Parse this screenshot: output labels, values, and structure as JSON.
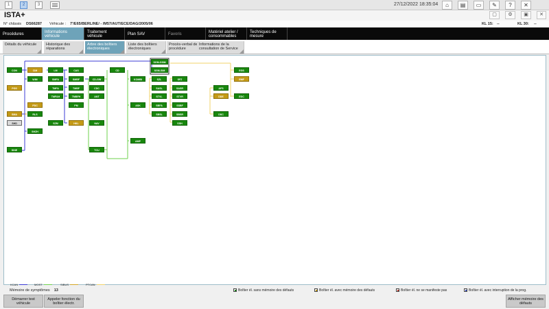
{
  "topbar": {
    "nav_buttons": [
      "1",
      "2",
      "3"
    ],
    "datetime": "27/12/2022 18:35:04",
    "icons": [
      "home-icon",
      "print-icon",
      "car-icon",
      "wrench-icon",
      "help-icon",
      "close-icon"
    ]
  },
  "app": {
    "title": "ISTA+"
  },
  "infobar": {
    "chassis_label": "N° châssis",
    "chassis_value": "DS66287",
    "vehicle_label": "Véhicule :",
    "vehicle_value": "7'/E65/BERLINE/ - /M57/AUT/ECE/DAG/2005/06",
    "kl15_label": "KL 15:",
    "kl15_value": "--",
    "kl30_label": "KL 30:",
    "kl30_value": "--"
  },
  "main_tabs": [
    {
      "label": "Procédures"
    },
    {
      "label": "Informations véhicule"
    },
    {
      "label": "Traitement véhicule"
    },
    {
      "label": "Plan SAV"
    },
    {
      "label": "Favoris"
    },
    {
      "label": "Matériel atelier / consommables"
    },
    {
      "label": "Techniques de mesure"
    }
  ],
  "sub_tabs": [
    {
      "label": "Détails du véhicule"
    },
    {
      "label": "Historique des réparations"
    },
    {
      "label": "Arbre des boîtiers électroniques"
    },
    {
      "label": "Liste des boîtiers électroniques"
    },
    {
      "label": "Procès-verbal de procédure"
    },
    {
      "label": "Informations de la consultation de Service"
    }
  ],
  "ecus": [
    {
      "label": "CON",
      "color": "green"
    },
    {
      "label": "CIM",
      "color": "yellow"
    },
    {
      "label": "WIM",
      "color": "green"
    },
    {
      "label": "PGS",
      "color": "yellow"
    },
    {
      "label": "PDC",
      "color": "yellow"
    },
    {
      "label": "SMA",
      "color": "yellow"
    },
    {
      "label": "RLS",
      "color": "green"
    },
    {
      "label": "SHD",
      "color": "grey"
    },
    {
      "label": "SHZH",
      "color": "green"
    },
    {
      "label": "SINE",
      "color": "green"
    },
    {
      "label": "LM",
      "color": "green"
    },
    {
      "label": "SMFA",
      "color": "green"
    },
    {
      "label": "TMFA",
      "color": "green"
    },
    {
      "label": "TMFAH",
      "color": "green"
    },
    {
      "label": "SZM",
      "color": "green"
    },
    {
      "label": "CAS",
      "color": "green"
    },
    {
      "label": "SMBF",
      "color": "green"
    },
    {
      "label": "TMBF",
      "color": "green"
    },
    {
      "label": "TMBFH",
      "color": "green"
    },
    {
      "label": "PM",
      "color": "green"
    },
    {
      "label": "HKL",
      "color": "yellow"
    },
    {
      "label": "CD-GW",
      "color": "green"
    },
    {
      "label": "CDC",
      "color": "green"
    },
    {
      "label": "ANT",
      "color": "green"
    },
    {
      "label": "NAV",
      "color": "green"
    },
    {
      "label": "TCU",
      "color": "green"
    },
    {
      "label": "CD",
      "color": "green"
    },
    {
      "label": "KOMBI",
      "color": "green"
    },
    {
      "label": "ASK",
      "color": "green"
    },
    {
      "label": "AMP",
      "color": "green"
    },
    {
      "label": "SGM-GGM",
      "color": "green"
    },
    {
      "label": "SGM-SIM",
      "color": "green"
    },
    {
      "label": "SZL",
      "color": "green"
    },
    {
      "label": "SASL",
      "color": "green"
    },
    {
      "label": "STVL",
      "color": "green"
    },
    {
      "label": "SBFA",
      "color": "green"
    },
    {
      "label": "SBSL",
      "color": "green"
    },
    {
      "label": "SFZ",
      "color": "green"
    },
    {
      "label": "SASR",
      "color": "green"
    },
    {
      "label": "STVR",
      "color": "green"
    },
    {
      "label": "SSBF",
      "color": "green"
    },
    {
      "label": "SBSR",
      "color": "green"
    },
    {
      "label": "SSH",
      "color": "green"
    },
    {
      "label": "AFS",
      "color": "green"
    },
    {
      "label": "DDE",
      "color": "yellow"
    },
    {
      "label": "DSC",
      "color": "green"
    },
    {
      "label": "EGS",
      "color": "green"
    },
    {
      "label": "EMF",
      "color": "yellow"
    },
    {
      "label": "EDC",
      "color": "green"
    }
  ],
  "bus_legend": [
    {
      "label": "KCAN",
      "color": "#3b3bd6"
    },
    {
      "label": "MOST",
      "color": "#6dd24b"
    },
    {
      "label": "SIBUS",
      "color": "#d5a623"
    },
    {
      "label": "PTCAN",
      "color": "#f2d36a"
    }
  ],
  "symptoms": {
    "label": "Mémoire de symptômes",
    "count": "13"
  },
  "status_legend": [
    {
      "label": "Boîtier él. sans mémoire des défauts",
      "color": "#18870d"
    },
    {
      "label": "Boîtier él. avec mémoire des défauts",
      "color": "#c49a16"
    },
    {
      "label": "Boîtier él. ne se manifeste pas",
      "color": "#c0392b"
    },
    {
      "label": "Boîtier él. avec interruption de la prog.",
      "color": "#3a4fc0"
    }
  ],
  "bottom_buttons": {
    "start_test": "Démarrer test véhicule",
    "call_function": "Appeler fonction du boîtier électr.",
    "show_faults": "Afficher mémoire des défauts"
  }
}
